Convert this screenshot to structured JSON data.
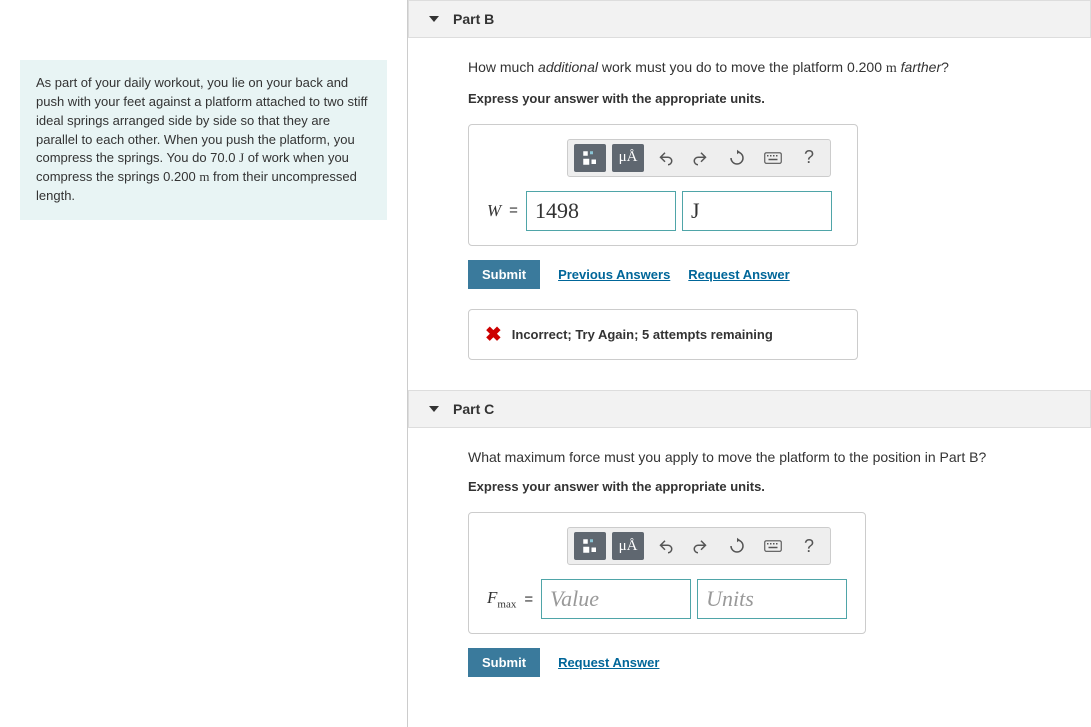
{
  "problem": {
    "text_pre": "As part of your daily workout, you lie on your back and push with your feet against a platform attached to two stiff ideal springs arranged side by side so that they are parallel to each other. When you push the platform, you compress the springs. You do 70.0 ",
    "unit1": "J",
    "text_mid": " of work when you compress the springs 0.200 ",
    "unit2": "m",
    "text_post": " from their uncompressed length."
  },
  "partB": {
    "label": "Part B",
    "q_pre": "How much ",
    "q_italic": "additional",
    "q_mid": " work must you do to move the platform 0.200 ",
    "q_unit": "m",
    "q_post_italic": " farther",
    "q_end": "?",
    "instruction": "Express your answer with the appropriate units.",
    "var": "W",
    "value": "1498",
    "units": "J",
    "submit": "Submit",
    "prev": "Previous Answers",
    "request": "Request Answer",
    "feedback": "Incorrect; Try Again; 5 attempts remaining"
  },
  "partC": {
    "label": "Part C",
    "question": "What maximum force must you apply to move the platform to the position in Part B?",
    "instruction": "Express your answer with the appropriate units.",
    "var": "F",
    "var_sub": "max",
    "value_placeholder": "Value",
    "units_placeholder": "Units",
    "submit": "Submit",
    "request": "Request Answer"
  },
  "toolbar": {
    "templates": "templates",
    "symbols": "μÅ",
    "undo": "undo",
    "redo": "redo",
    "reset": "reset",
    "keyboard": "keyboard",
    "help": "?"
  }
}
